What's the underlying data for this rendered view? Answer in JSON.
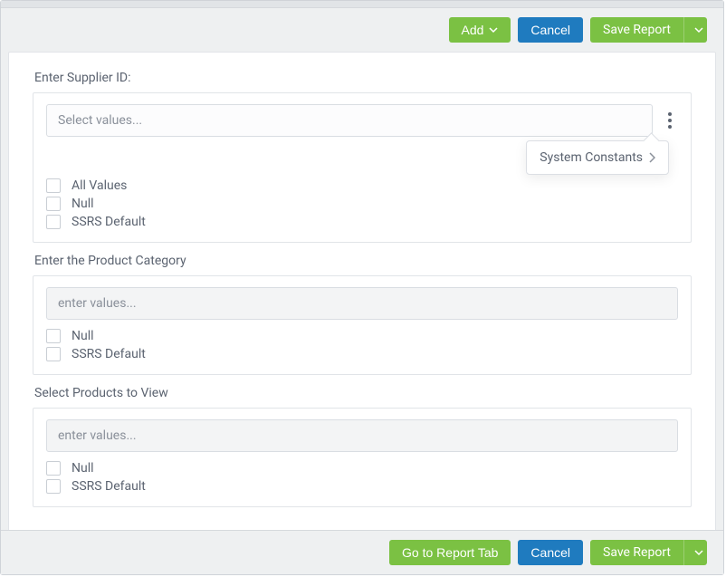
{
  "toolbar": {
    "add_label": "Add",
    "cancel_label": "Cancel",
    "save_label": "Save Report"
  },
  "sections": {
    "supplier": {
      "label": "Enter Supplier ID:",
      "placeholder": "Select values...",
      "popover_label": "System Constants",
      "options": {
        "all_values": "All Values",
        "null": "Null",
        "ssrs_default": "SSRS Default"
      }
    },
    "category": {
      "label": "Enter the Product Category",
      "placeholder": "enter values...",
      "options": {
        "null": "Null",
        "ssrs_default": "SSRS Default"
      }
    },
    "products": {
      "label": "Select Products to View",
      "placeholder": "enter values...",
      "options": {
        "null": "Null",
        "ssrs_default": "SSRS Default"
      }
    }
  },
  "footer": {
    "go_to_report_label": "Go to Report Tab",
    "cancel_label": "Cancel",
    "save_label": "Save Report"
  }
}
